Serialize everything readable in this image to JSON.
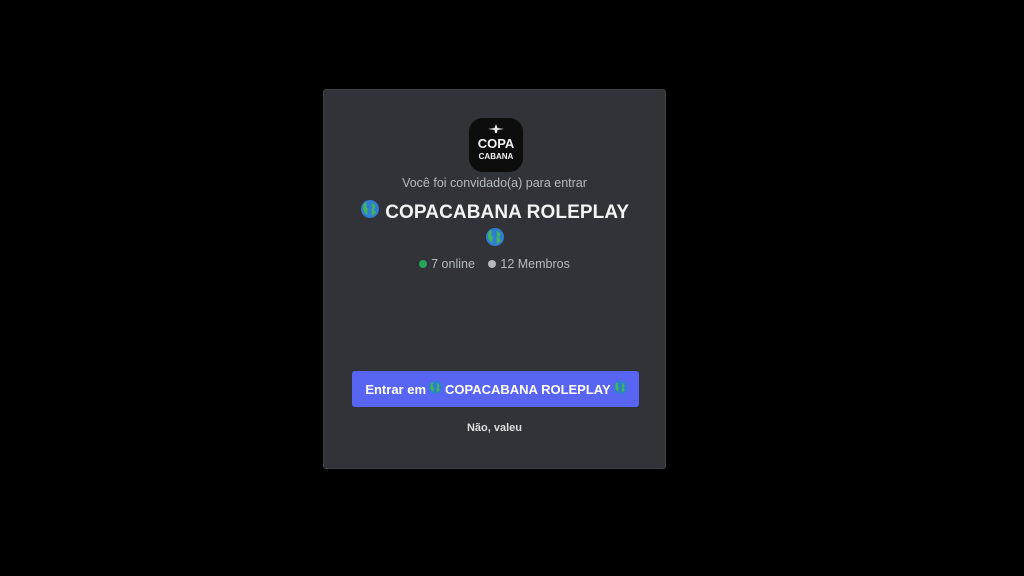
{
  "invite": {
    "subtitle": "Você foi convidado(a) para entrar",
    "server_name": "COPACABANA ROLEPLAY",
    "server_emoji": "globe-icon",
    "logo_text_top": "COPA",
    "logo_text_bottom": "CABANA",
    "online_count": "7 online",
    "member_count": "12 Membros",
    "join_prefix": "Entrar em",
    "join_server_name": "COPACABANA ROLEPLAY",
    "decline_label": "Não, valeu"
  },
  "colors": {
    "background": "#000000",
    "modal": "#313338",
    "accent": "#5865f2",
    "online": "#23a55a",
    "members": "#b5bac1"
  }
}
